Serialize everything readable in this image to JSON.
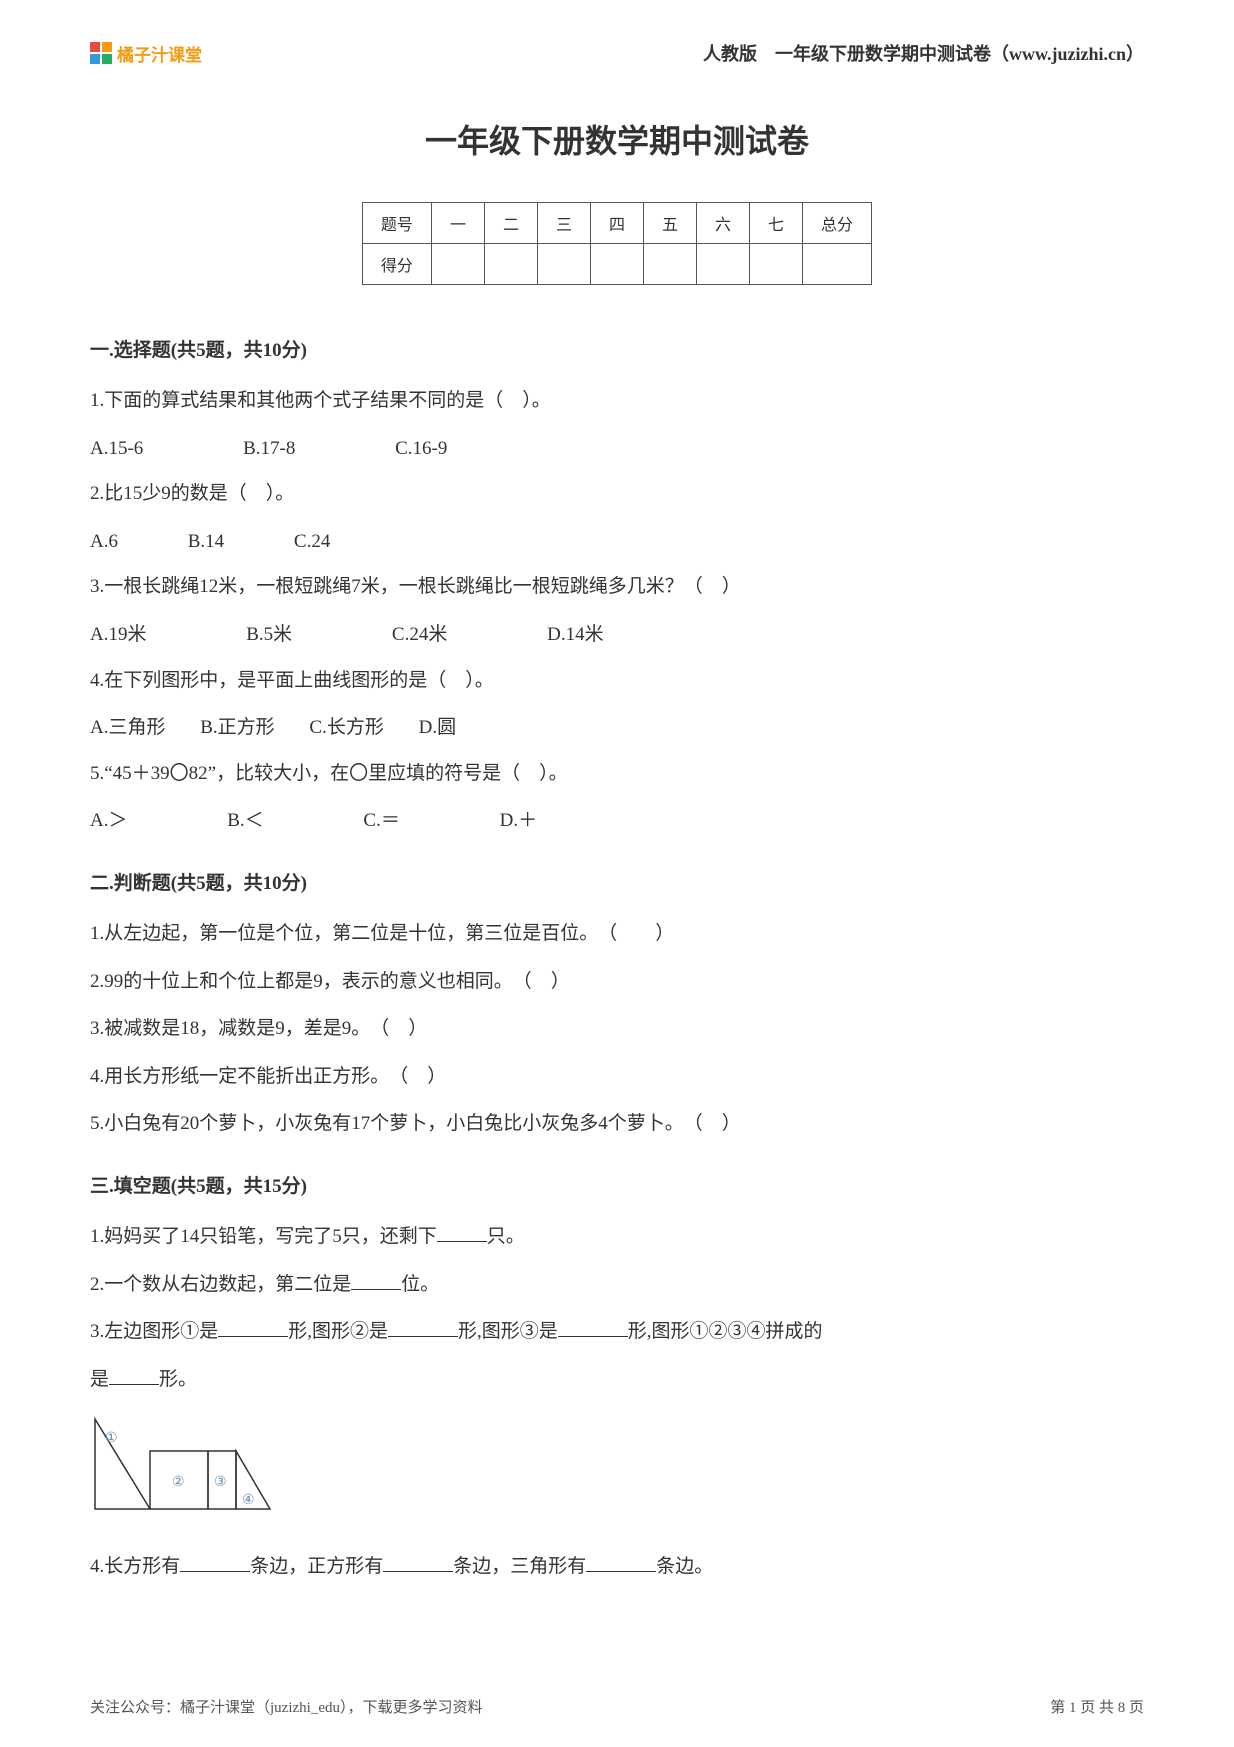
{
  "header": {
    "logo_text": "橘子汁课堂",
    "right": "人教版　一年级下册数学期中测试卷（www.juzizhi.cn）"
  },
  "title": "一年级下册数学期中测试卷",
  "score_table": {
    "row1": [
      "题号",
      "一",
      "二",
      "三",
      "四",
      "五",
      "六",
      "七",
      "总分"
    ],
    "row2_label": "得分"
  },
  "sections": {
    "s1": {
      "head": "一.选择题(共5题，共10分)",
      "q1": "1.下面的算式结果和其他两个式子结果不同的是（　）。",
      "q1a": "A.15-6",
      "q1b": "B.17-8",
      "q1c": "C.16-9",
      "q2": "2.比15少9的数是（　）。",
      "q2a": "A.6",
      "q2b": "B.14",
      "q2c": "C.24",
      "q3": "3.一根长跳绳12米，一根短跳绳7米，一根长跳绳比一根短跳绳多几米？（　）",
      "q3a": "A.19米",
      "q3b": "B.5米",
      "q3c": "C.24米",
      "q3d": "D.14米",
      "q4": "4.在下列图形中，是平面上曲线图形的是（　）。",
      "q4a": "A.三角形",
      "q4b": "B.正方形",
      "q4c": "C.长方形",
      "q4d": "D.圆",
      "q5": "5.“45＋39〇82”，比较大小，在〇里应填的符号是（　）。",
      "q5a": "A.＞",
      "q5b": "B.＜",
      "q5c": "C.＝",
      "q5d": "D.＋"
    },
    "s2": {
      "head": "二.判断题(共5题，共10分)",
      "q1": "1.从左边起，第一位是个位，第二位是十位，第三位是百位。　（　　）",
      "q2": "2.99的十位上和个位上都是9，表示的意义也相同。　（　）",
      "q3": "3.被减数是18，减数是9，差是9。　（　）",
      "q4": "4.用长方形纸一定不能折出正方形。　（　）",
      "q5": "5.小白兔有20个萝卜，小灰兔有17个萝卜，小白兔比小灰兔多4个萝卜。　（　）"
    },
    "s3": {
      "head": "三.填空题(共5题，共15分)",
      "q1p1": "1.妈妈买了14只铅笔，写完了5只，还剩下",
      "q1p2": "只。",
      "q2p1": "2.一个数从右边数起，第二位是",
      "q2p2": "位。",
      "q3p1": "3.左边图形①是",
      "q3p2": "形,图形②是",
      "q3p3": "形,图形③是",
      "q3p4": "形,图形①②③④拼成的",
      "q3p5": "是",
      "q3p6": "形。",
      "shape_labels": {
        "c1": "①",
        "c2": "②",
        "c3": "③",
        "c4": "④"
      },
      "q4p1": "4.长方形有",
      "q4p2": "条边，正方形有",
      "q4p3": "条边，三角形有",
      "q4p4": "条边。"
    }
  },
  "footer": {
    "left": "关注公众号：橘子汁课堂（juzizhi_edu），下载更多学习资料",
    "right": "第 1 页 共 8 页"
  }
}
